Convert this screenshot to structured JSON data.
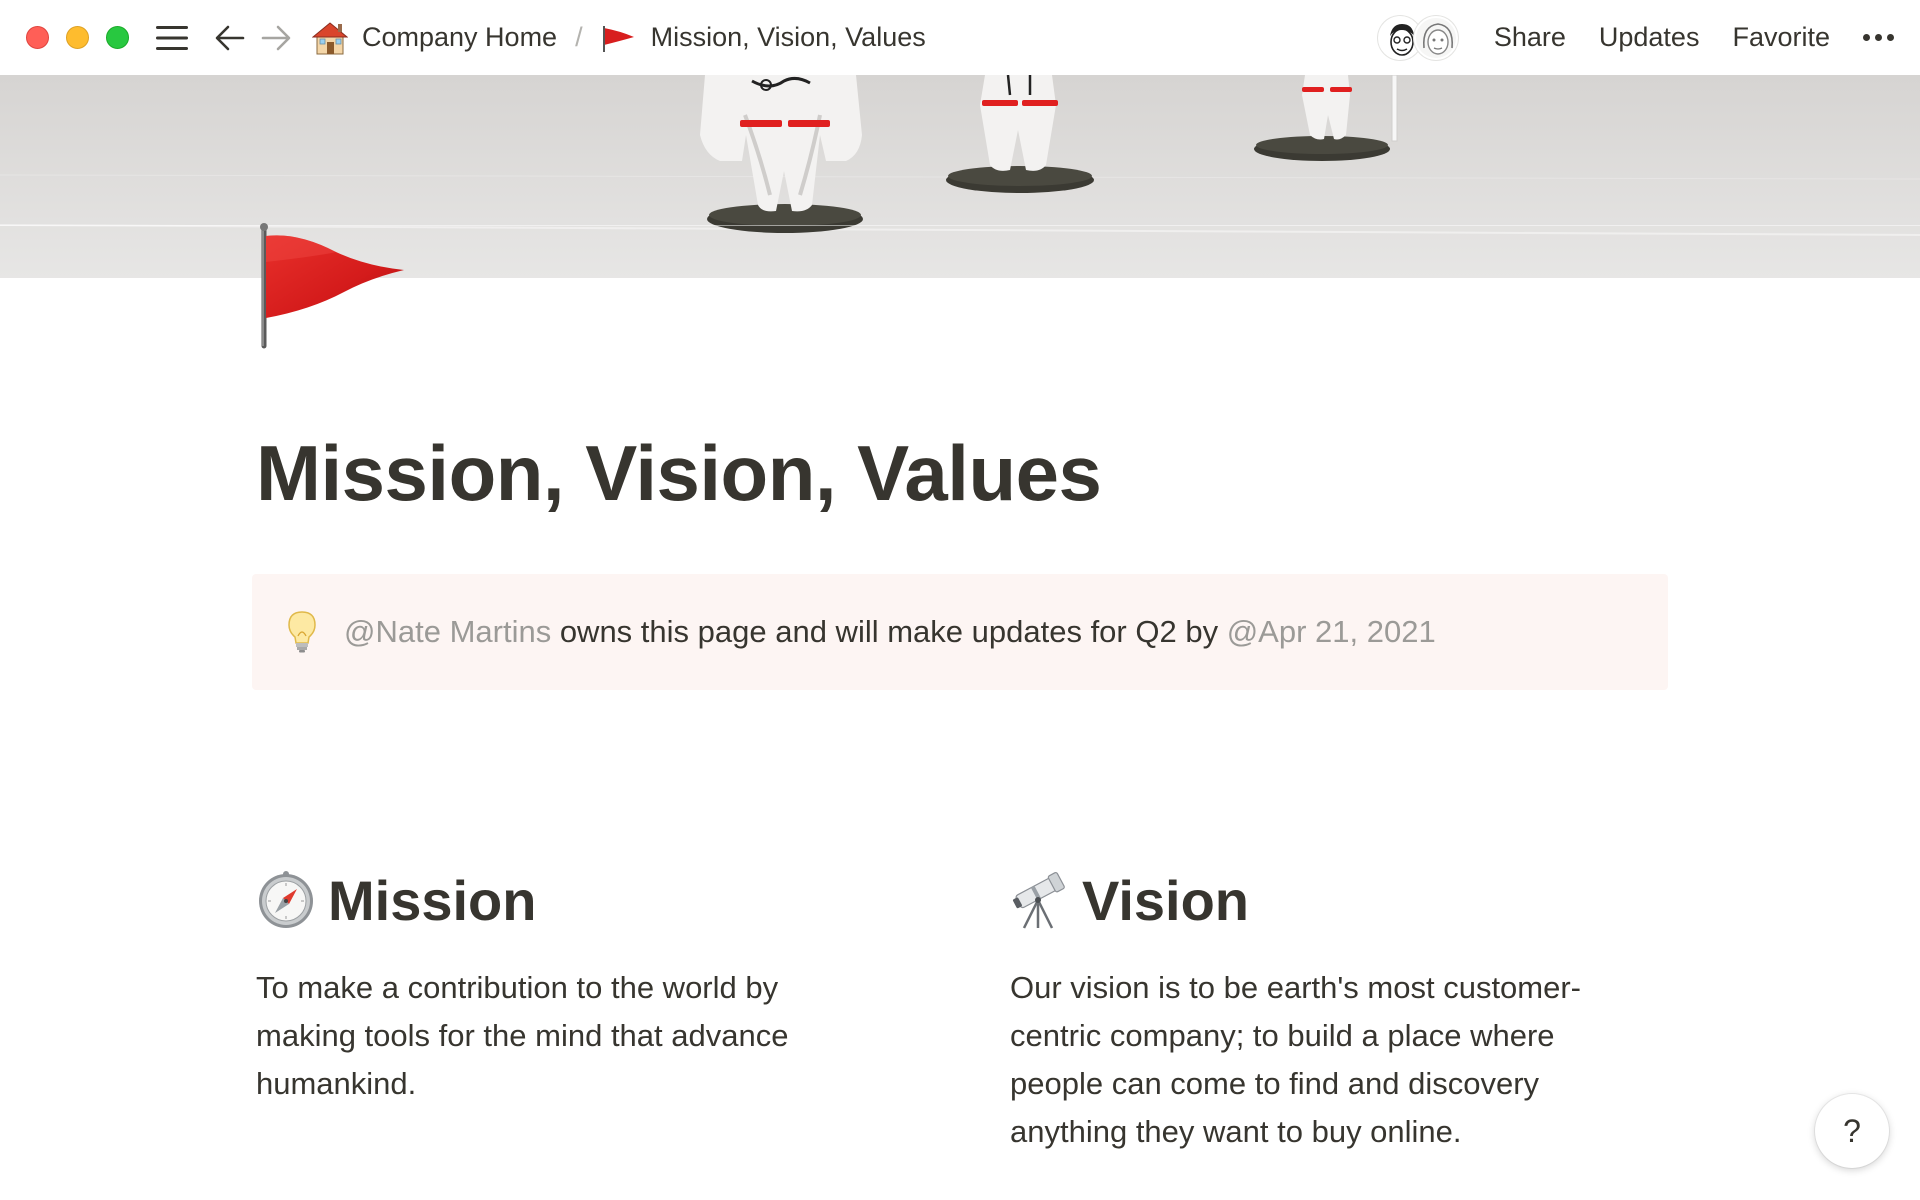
{
  "window": {
    "controls": [
      "close",
      "minimize",
      "maximize"
    ]
  },
  "toolbar": {
    "menu_icon": "hamburger-menu-icon",
    "back_icon": "arrow-left-icon",
    "forward_icon": "arrow-right-icon"
  },
  "breadcrumb": {
    "items": [
      {
        "icon": "house-icon",
        "label": "Company Home"
      },
      {
        "icon": "red-flag-icon",
        "label": "Mission, Vision, Values"
      }
    ],
    "separator": "/"
  },
  "topbar": {
    "share_label": "Share",
    "updates_label": "Updates",
    "favorite_label": "Favorite",
    "more_icon": "more-dots-icon"
  },
  "page": {
    "icon": "red-flag-icon",
    "title": "Mission, Vision, Values",
    "callout": {
      "icon": "lightbulb-icon",
      "owner_mention": "@Nate Martins",
      "text": " owns this page and will make updates for Q2 by ",
      "date_mention": "@Apr 21, 2021"
    },
    "columns": [
      {
        "icon": "compass-icon",
        "heading": "Mission",
        "body": "To make a contribution to the world by making tools for the mind that advance humankind."
      },
      {
        "icon": "telescope-icon",
        "heading": "Vision",
        "body": "Our vision is to be earth's most customer-centric company; to build a place where people can come to find and discovery anything they want to buy online."
      }
    ]
  },
  "help": {
    "label": "?"
  },
  "colors": {
    "text": "#37352f",
    "muted": "#9b9a97",
    "callout_bg": "#fdf5f3",
    "flag_red": "#d81e1e"
  }
}
